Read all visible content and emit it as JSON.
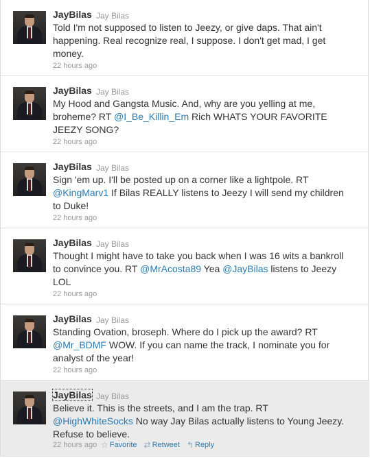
{
  "tweets": [
    {
      "screen_name": "JayBilas",
      "real_name": "Jay Bilas",
      "text_lines": [
        [
          {
            "t": "Told I'm not supposed to listen to Jeezy, or give daps. That ain't"
          }
        ],
        [
          {
            "t": "happening. Real recognize real, I suppose. I don't get mad, I get"
          }
        ],
        [
          {
            "t": "money."
          }
        ]
      ],
      "time": "22 hours ago"
    },
    {
      "screen_name": "JayBilas",
      "real_name": "Jay Bilas",
      "text_lines": [
        [
          {
            "t": "My Hood and Gangsta Music. And, why are you yelling at me,"
          }
        ],
        [
          {
            "t": "broheme? RT "
          },
          {
            "t": "@I_Be_Killin_Em",
            "m": true
          },
          {
            "t": " Rich WHATS YOUR FAVORITE"
          }
        ],
        [
          {
            "t": "JEEZY SONG?"
          }
        ]
      ],
      "time": "22 hours ago"
    },
    {
      "screen_name": "JayBilas",
      "real_name": "Jay Bilas",
      "text_lines": [
        [
          {
            "t": "Sign 'em up. I'll be posted up on a corner like a lightpole. RT"
          }
        ],
        [
          {
            "t": "@KingMarv1",
            "m": true
          },
          {
            "t": " If Bilas REALLY listens to Jeezy I will send my children"
          }
        ],
        [
          {
            "t": "to Duke!"
          }
        ]
      ],
      "time": "22 hours ago"
    },
    {
      "screen_name": "JayBilas",
      "real_name": "Jay Bilas",
      "text_lines": [
        [
          {
            "t": "Thought I might have to take you back when I was 16 wits a bankroll"
          }
        ],
        [
          {
            "t": "to convince you. RT "
          },
          {
            "t": "@MrAcosta89",
            "m": true
          },
          {
            "t": " Yea "
          },
          {
            "t": "@JayBilas",
            "m": true
          },
          {
            "t": " listens to Jeezy"
          }
        ],
        [
          {
            "t": "LOL"
          }
        ]
      ],
      "time": "22 hours ago"
    },
    {
      "screen_name": "JayBilas",
      "real_name": "Jay Bilas",
      "text_lines": [
        [
          {
            "t": "Standing Ovation, broseph. Where do I pick up the award? RT"
          }
        ],
        [
          {
            "t": "@Mr_BDMF",
            "m": true
          },
          {
            "t": " WOW. If you can name the track, I nominate you for"
          }
        ],
        [
          {
            "t": "analyst of the year!"
          }
        ]
      ],
      "time": "22 hours ago"
    },
    {
      "screen_name": "JayBilas",
      "real_name": "Jay Bilas",
      "text_lines": [
        [
          {
            "t": "Believe it. This is the streets, and I am the trap. RT"
          }
        ],
        [
          {
            "t": "@HighWhiteSocks",
            "m": true
          },
          {
            "t": " No way Jay Bilas actually listens to Young Jeezy."
          }
        ],
        [
          {
            "t": "Refuse to believe."
          }
        ]
      ],
      "time": "22 hours ago",
      "actions": {
        "favorite_icon": "star-icon",
        "favorite_label": "Favorite",
        "retweet_icon": "retweet-icon",
        "retweet_label": "Retweet",
        "reply_icon": "reply-icon",
        "reply_label": "Reply"
      }
    }
  ],
  "colors": {
    "mention": "#2a7ab0",
    "meta": "#999999",
    "text": "#333333",
    "hover_bg": "#ebebeb"
  }
}
